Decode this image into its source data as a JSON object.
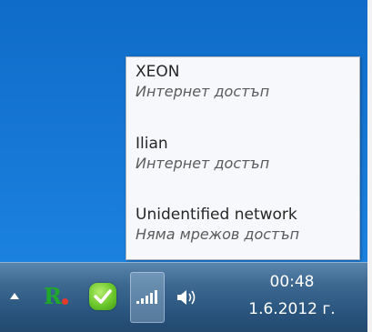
{
  "popup": {
    "networks": [
      {
        "name": "XEON",
        "status": "Интернет достъп"
      },
      {
        "name": "Ilian",
        "status": "Интернет достъп"
      },
      {
        "name": "Unidentified network",
        "status": "Няма мрежов достъп"
      }
    ]
  },
  "taskbar": {
    "clock": {
      "time": "00:48",
      "date": "1.6.2012 г."
    },
    "tray_icons": [
      "show-hidden-icons-arrow",
      "r-app-icon",
      "green-check-icon",
      "network-signal-icon",
      "volume-icon"
    ]
  }
}
